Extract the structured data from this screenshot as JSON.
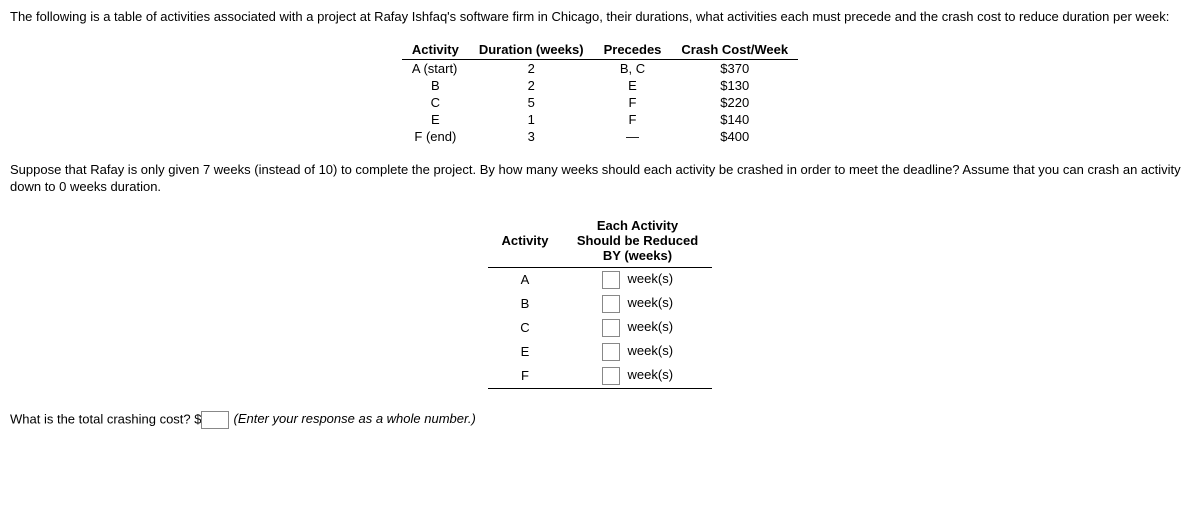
{
  "intro": "The following is a table of activities associated with a project at Rafay Ishfaq's software firm in Chicago, their durations, what activities each must precede and the crash cost to reduce duration per week:",
  "table1": {
    "headers": [
      "Activity",
      "Duration (weeks)",
      "Precedes",
      "Crash Cost/Week"
    ],
    "rows": [
      {
        "activity": "A (start)",
        "duration": "2",
        "precedes": "B, C",
        "cost": "$370"
      },
      {
        "activity": "B",
        "duration": "2",
        "precedes": "E",
        "cost": "$130"
      },
      {
        "activity": "C",
        "duration": "5",
        "precedes": "F",
        "cost": "$220"
      },
      {
        "activity": "E",
        "duration": "1",
        "precedes": "F",
        "cost": "$140"
      },
      {
        "activity": "F (end)",
        "duration": "3",
        "precedes": "—",
        "cost": "$400"
      }
    ]
  },
  "question": "Suppose that Rafay is only given 7 weeks (instead of 10) to complete the project. By how many weeks should each activity be crashed in order to meet the deadline? Assume that you can crash an activity down to 0 weeks duration.",
  "table2": {
    "header_activity": "Activity",
    "header_reduce": "Each Activity Should be Reduced BY (weeks)",
    "unit": "week(s)",
    "rows": [
      {
        "activity": "A"
      },
      {
        "activity": "B"
      },
      {
        "activity": "C"
      },
      {
        "activity": "E"
      },
      {
        "activity": "F"
      }
    ]
  },
  "final": {
    "label_pre": "What is the total crashing cost? $",
    "hint": "(Enter your response as a whole number.)"
  }
}
